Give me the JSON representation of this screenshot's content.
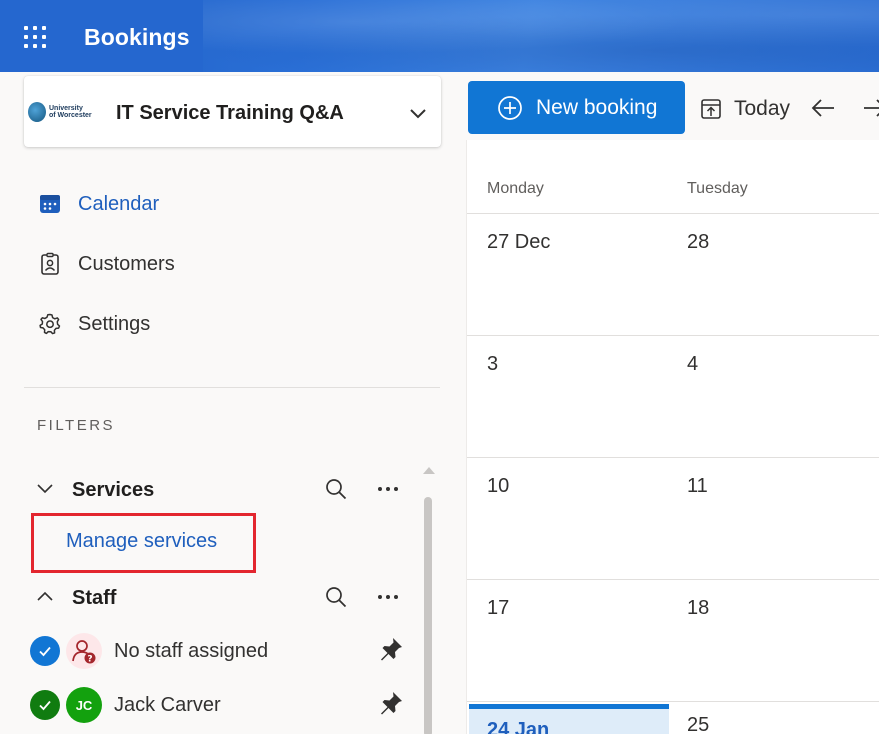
{
  "header": {
    "app_name": "Bookings",
    "icon": "app-launcher-icon"
  },
  "business": {
    "name": "IT Service Training Q&A",
    "logo_text_line1": "University",
    "logo_text_line2": "of Worcester",
    "chevron_icon": "chevron-down-icon"
  },
  "nav": {
    "items": [
      {
        "label": "Calendar",
        "icon": "calendar-icon",
        "active": true
      },
      {
        "label": "Customers",
        "icon": "customers-icon",
        "active": false
      },
      {
        "label": "Settings",
        "icon": "gear-icon",
        "active": false
      }
    ]
  },
  "filters": {
    "title": "FILTERS",
    "services": {
      "title": "Services",
      "manage_link": "Manage services"
    },
    "staff": {
      "title": "Staff",
      "members": [
        {
          "name": "No staff assigned",
          "avatar": "unassigned-person-icon",
          "checked": true
        },
        {
          "name": "Jack Carver",
          "initials": "JC",
          "checked": true
        }
      ]
    }
  },
  "toolbar": {
    "new_booking_label": "New booking",
    "today_label": "Today"
  },
  "calendar": {
    "day_headers": [
      "Monday",
      "Tuesday"
    ],
    "weeks": [
      [
        "27 Dec",
        "28"
      ],
      [
        "3",
        "4"
      ],
      [
        "10",
        "11"
      ],
      [
        "17",
        "18"
      ],
      [
        "24 Jan",
        "25"
      ]
    ],
    "today": "24 Jan"
  },
  "colors": {
    "accent": "#1176d4",
    "highlight": "#e3262f",
    "link": "#1f5fbd",
    "header": "#2567cf"
  }
}
